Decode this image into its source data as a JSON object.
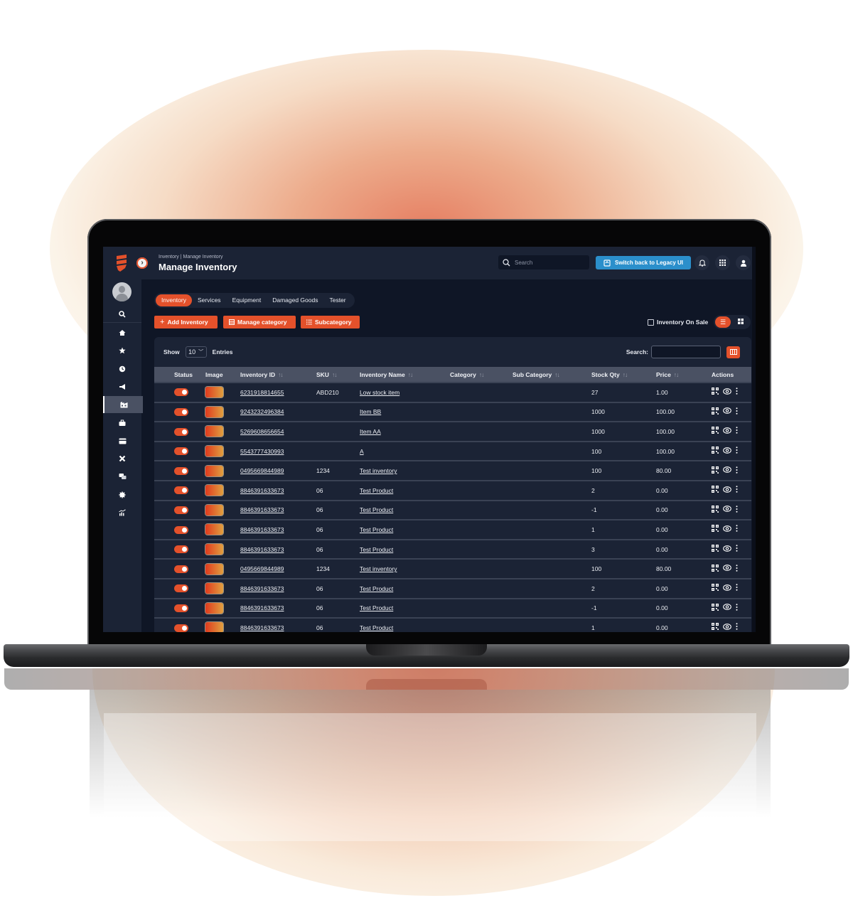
{
  "colors": {
    "accent": "#e4512b",
    "legacy_button": "#2b8fcb",
    "screen_bg": "#0f1626",
    "panel_bg": "#1b2335",
    "table_header_bg": "#4a5163"
  },
  "header": {
    "breadcrumb": "Inventory | Manage Inventory",
    "title": "Manage Inventory",
    "search_placeholder": "Search",
    "legacy_button_label": "Switch back to Legacy UI"
  },
  "sidebar": {
    "items": [
      {
        "icon": "search-icon"
      },
      {
        "icon": "home-icon"
      },
      {
        "icon": "star-icon"
      },
      {
        "icon": "clock-icon"
      },
      {
        "icon": "megaphone-icon"
      },
      {
        "icon": "warehouse-icon",
        "active": true
      },
      {
        "icon": "briefcase-icon"
      },
      {
        "icon": "credit-card-icon"
      },
      {
        "icon": "tools-icon"
      },
      {
        "icon": "chat-icon"
      },
      {
        "icon": "gear-icon"
      },
      {
        "icon": "analytics-icon"
      }
    ]
  },
  "tabs": [
    {
      "label": "Inventory",
      "active": true
    },
    {
      "label": "Services"
    },
    {
      "label": "Equipment"
    },
    {
      "label": "Damaged Goods"
    },
    {
      "label": "Tester"
    }
  ],
  "actions": {
    "add_inventory": "Add Inventory",
    "manage_category": "Manage category",
    "subcategory": "Subcategory",
    "inventory_on_sale": "Inventory On Sale"
  },
  "table_controls": {
    "show_label": "Show",
    "entries_value": "10",
    "entries_label": "Entries",
    "search_label": "Search:",
    "search_value": ""
  },
  "table": {
    "columns": [
      "Status",
      "Image",
      "Inventory ID",
      "SKU",
      "Inventory Name",
      "Category",
      "Sub Category",
      "Stock Qty",
      "Price",
      "Actions"
    ],
    "sortable": [
      false,
      false,
      true,
      true,
      true,
      true,
      true,
      true,
      true,
      false
    ],
    "rows": [
      {
        "id": "6231918814655",
        "sku": "ABD210",
        "name": "Low stock item",
        "category": "",
        "subcategory": "",
        "qty": "27",
        "price": "1.00"
      },
      {
        "id": "9243232496384",
        "sku": "",
        "name": "Item BB",
        "category": "",
        "subcategory": "",
        "qty": "1000",
        "price": "100.00"
      },
      {
        "id": "5269608656654",
        "sku": "",
        "name": "Item AA",
        "category": "",
        "subcategory": "",
        "qty": "1000",
        "price": "100.00"
      },
      {
        "id": "5543777430993",
        "sku": "",
        "name": "A",
        "category": "",
        "subcategory": "",
        "qty": "100",
        "price": "100.00"
      },
      {
        "id": "0495669844989",
        "sku": "1234",
        "name": "Test inventory",
        "category": "",
        "subcategory": "",
        "qty": "100",
        "price": "80.00"
      },
      {
        "id": "8846391633673",
        "sku": "06",
        "name": "Test Product",
        "category": "",
        "subcategory": "",
        "qty": "2",
        "price": "0.00"
      },
      {
        "id": "8846391633673",
        "sku": "06",
        "name": "Test Product",
        "category": "",
        "subcategory": "",
        "qty": "-1",
        "price": "0.00"
      },
      {
        "id": "8846391633673",
        "sku": "06",
        "name": "Test Product",
        "category": "",
        "subcategory": "",
        "qty": "1",
        "price": "0.00"
      },
      {
        "id": "8846391633673",
        "sku": "06",
        "name": "Test Product",
        "category": "",
        "subcategory": "",
        "qty": "3",
        "price": "0.00"
      },
      {
        "id": "0495669844989",
        "sku": "1234",
        "name": "Test inventory",
        "category": "",
        "subcategory": "",
        "qty": "100",
        "price": "80.00"
      },
      {
        "id": "8846391633673",
        "sku": "06",
        "name": "Test Product",
        "category": "",
        "subcategory": "",
        "qty": "2",
        "price": "0.00"
      },
      {
        "id": "8846391633673",
        "sku": "06",
        "name": "Test Product",
        "category": "",
        "subcategory": "",
        "qty": "-1",
        "price": "0.00"
      },
      {
        "id": "8846391633673",
        "sku": "06",
        "name": "Test Product",
        "category": "",
        "subcategory": "",
        "qty": "1",
        "price": "0.00"
      }
    ]
  }
}
